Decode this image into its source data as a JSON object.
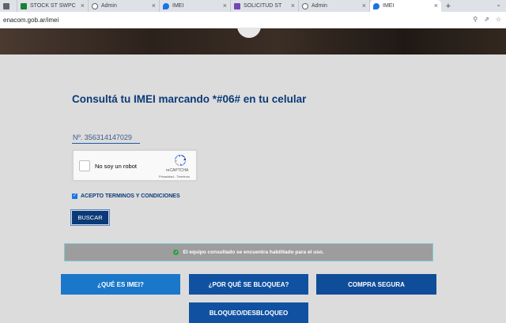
{
  "browser": {
    "tabs": [
      {
        "label": "",
        "icon": "page-icon",
        "color": "#5f6368"
      },
      {
        "label": "STOCK ST SWPC",
        "icon": "sheets-icon",
        "color": "#188038"
      },
      {
        "label": "Admin",
        "icon": "globe-icon",
        "color": "#5f6368"
      },
      {
        "label": "IMEI",
        "icon": "enacom-icon",
        "color": "#1a73e8"
      },
      {
        "label": "SOLICITUD ST",
        "icon": "forms-icon",
        "color": "#7248b9"
      },
      {
        "label": "Admin",
        "icon": "globe-icon",
        "color": "#5f6368"
      },
      {
        "label": "IMEI",
        "icon": "enacom-icon",
        "color": "#1a73e8"
      }
    ],
    "active_tab_index": 6,
    "new_tab": "+",
    "url": "enacom.gob.ar/imei"
  },
  "page": {
    "title": "Consultá tu IMEI marcando *#06# en tu celular",
    "imei_value": "Nº. 356314147029",
    "captcha": {
      "label": "No soy un robot",
      "brand": "reCAPTCHA",
      "links": "Privacidad - Términos"
    },
    "terms_label": "ACEPTO TERMINOS Y CONDICIONES",
    "terms_checked": true,
    "search_button": "BUSCAR",
    "result_message": "El equipo consultado se encuentra habilitado para el uso.",
    "nav_buttons": {
      "what_is": "¿QUÉ ES IMEI?",
      "why_blocked": "¿POR QUÉ SE BLOQUEA?",
      "safe_purchase": "COMPRA SEGURA",
      "block_unblock": "BLOQUEO/DESBLOQUEO"
    }
  },
  "colors": {
    "primary": "#0a3a78",
    "button_light": "#1a77c9",
    "success": "#2f9e44",
    "result_bg": "#9d9d9d"
  }
}
